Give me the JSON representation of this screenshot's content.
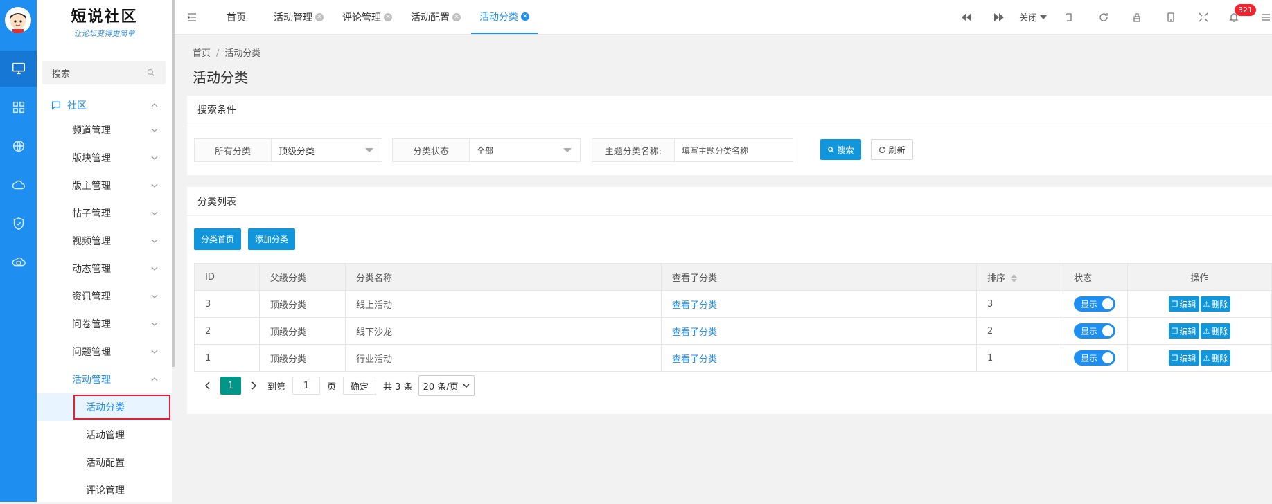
{
  "logo": {
    "title": "短说社区",
    "subtitle": "让论坛变得更简单"
  },
  "menu": {
    "search_placeholder": "搜索",
    "root": "社区",
    "items": [
      {
        "label": "频道管理"
      },
      {
        "label": "版块管理"
      },
      {
        "label": "版主管理"
      },
      {
        "label": "帖子管理"
      },
      {
        "label": "视频管理"
      },
      {
        "label": "动态管理"
      },
      {
        "label": "资讯管理"
      },
      {
        "label": "问卷管理"
      },
      {
        "label": "问题管理"
      },
      {
        "label": "活动管理"
      }
    ],
    "sub_items": [
      {
        "label": "活动分类"
      },
      {
        "label": "活动管理"
      },
      {
        "label": "活动配置"
      },
      {
        "label": "评论管理"
      }
    ]
  },
  "tabs": [
    {
      "label": "首页"
    },
    {
      "label": "活动管理"
    },
    {
      "label": "评论管理"
    },
    {
      "label": "活动配置"
    },
    {
      "label": "活动分类"
    }
  ],
  "toolbar": {
    "close_label": "关闭",
    "notification_count": "321"
  },
  "breadcrumb": {
    "home": "首页",
    "current": "活动分类"
  },
  "page_title": "活动分类",
  "search_card": {
    "title": "搜索条件",
    "category_label": "所有分类",
    "category_value": "顶级分类",
    "status_label": "分类状态",
    "status_value": "全部",
    "name_label": "主题分类名称:",
    "name_placeholder": "填写主题分类名称",
    "search_btn": "搜索",
    "refresh_btn": "刷新"
  },
  "list_card": {
    "title": "分类列表",
    "home_btn": "分类首页",
    "add_btn": "添加分类",
    "columns": [
      "ID",
      "父级分类",
      "分类名称",
      "查看子分类",
      "排序",
      "状态",
      "操作"
    ],
    "rows": [
      {
        "id": "3",
        "parent": "顶级分类",
        "name": "线上活动",
        "children": "查看子分类",
        "sort": "3",
        "status": "显示",
        "edit": "编辑",
        "delete": "删除"
      },
      {
        "id": "2",
        "parent": "顶级分类",
        "name": "线下沙龙",
        "children": "查看子分类",
        "sort": "2",
        "status": "显示",
        "edit": "编辑",
        "delete": "删除"
      },
      {
        "id": "1",
        "parent": "顶级分类",
        "name": "行业活动",
        "children": "查看子分类",
        "sort": "1",
        "status": "显示",
        "edit": "编辑",
        "delete": "删除"
      }
    ]
  },
  "pagination": {
    "current": "1",
    "goto_label": "到第",
    "goto_value": "1",
    "page_unit": "页",
    "confirm": "确定",
    "total": "共 3 条",
    "page_size": "20 条/页"
  }
}
